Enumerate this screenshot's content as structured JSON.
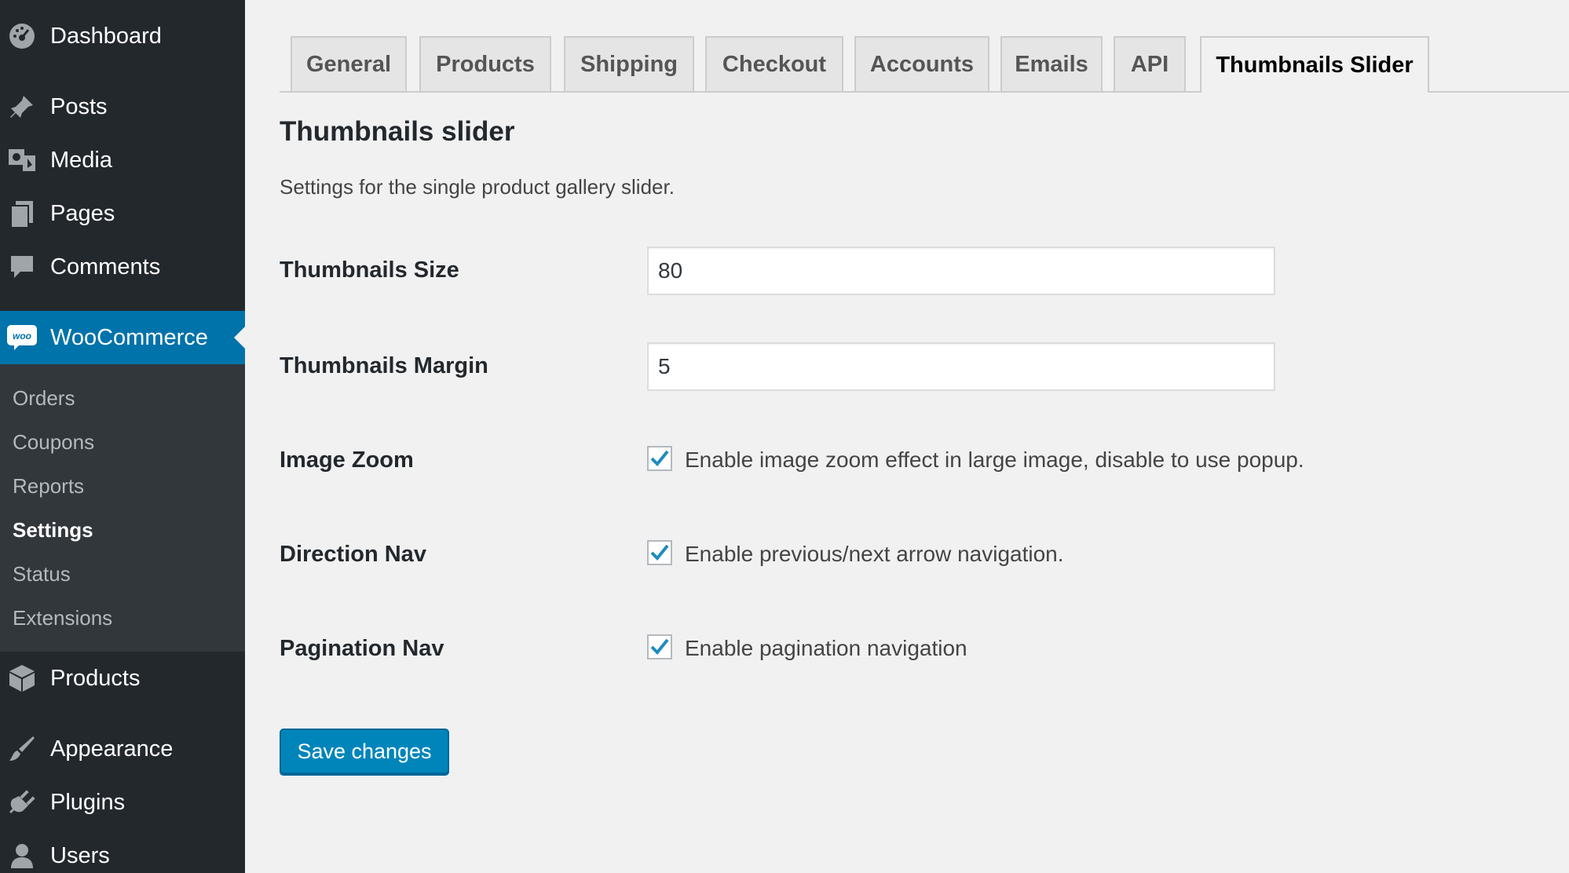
{
  "sidebar": {
    "top_items": [
      {
        "label": "Dashboard",
        "icon": "dashboard-icon"
      },
      {
        "label": "Posts",
        "icon": "pin-icon"
      },
      {
        "label": "Media",
        "icon": "media-icon"
      },
      {
        "label": "Pages",
        "icon": "pages-icon"
      },
      {
        "label": "Comments",
        "icon": "comment-icon"
      }
    ],
    "woocommerce": {
      "label": "WooCommerce",
      "icon": "woo-icon",
      "badge": "woo"
    },
    "submenu": [
      "Orders",
      "Coupons",
      "Reports",
      "Settings",
      "Status",
      "Extensions"
    ],
    "current_submenu": "Settings",
    "bottom_items": [
      {
        "label": "Products",
        "icon": "box-icon"
      },
      {
        "label": "Appearance",
        "icon": "paintbrush-icon"
      },
      {
        "label": "Plugins",
        "icon": "plug-icon"
      },
      {
        "label": "Users",
        "icon": "user-icon"
      }
    ]
  },
  "tabs": [
    "General",
    "Products",
    "Shipping",
    "Checkout",
    "Accounts",
    "Emails",
    "API",
    "Thumbnails Slider"
  ],
  "active_tab": "Thumbnails Slider",
  "section": {
    "title": "Thumbnails slider",
    "description": "Settings for the single product gallery slider."
  },
  "fields": {
    "thumb_size": {
      "label": "Thumbnails Size",
      "value": "80"
    },
    "thumb_margin": {
      "label": "Thumbnails Margin",
      "value": "5"
    },
    "image_zoom": {
      "label": "Image Zoom",
      "checked": true,
      "description": "Enable image zoom effect in large image, disable to use popup."
    },
    "direction_nav": {
      "label": "Direction Nav",
      "checked": true,
      "description": "Enable previous/next arrow navigation."
    },
    "pagination_nav": {
      "label": "Pagination Nav",
      "checked": true,
      "description": "Enable pagination navigation"
    }
  },
  "save_label": "Save changes",
  "colors": {
    "sidebar_bg": "#23282d",
    "submenu_bg": "#32373c",
    "accent": "#0073aa",
    "button": "#0085ba",
    "checkmark": "#1e8cbe"
  }
}
